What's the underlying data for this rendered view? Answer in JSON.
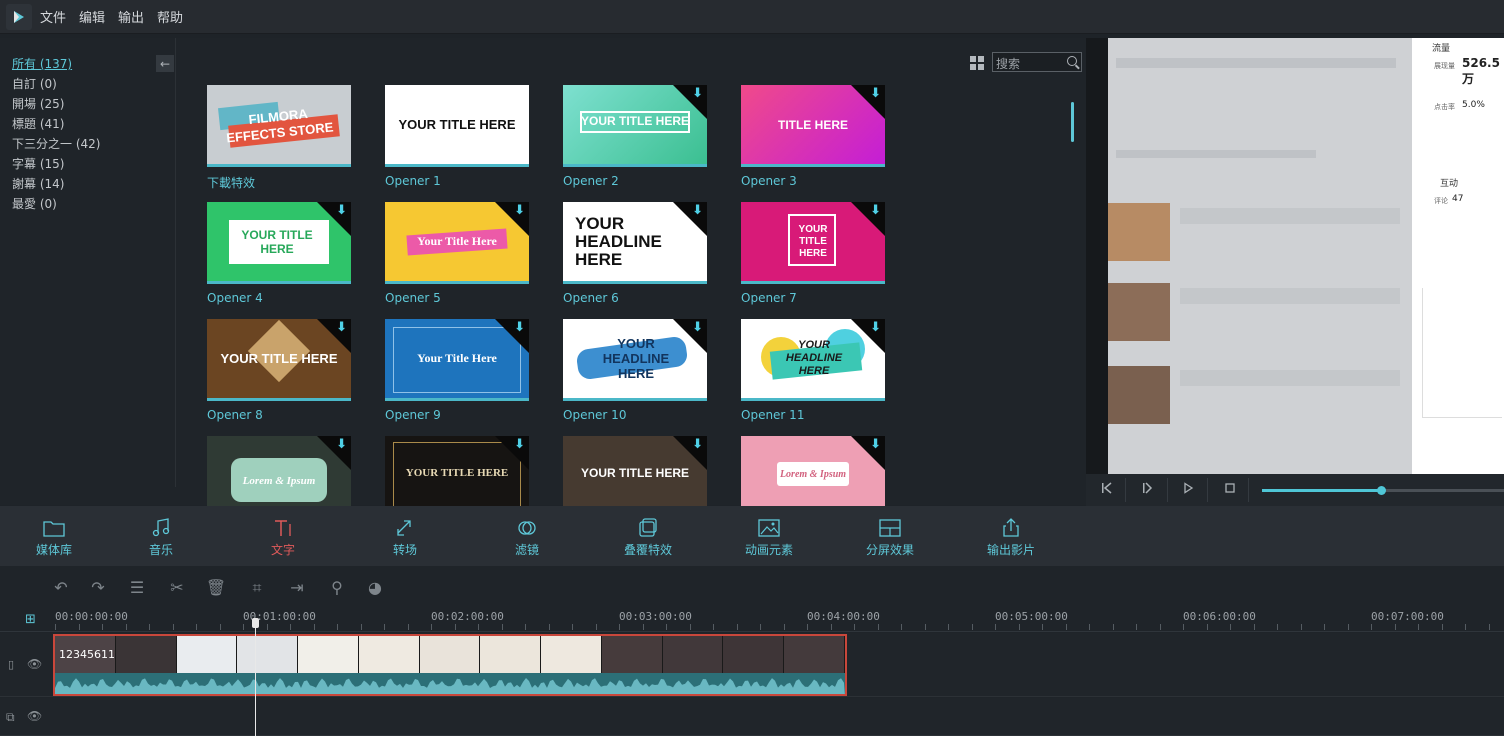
{
  "menu": {
    "items": [
      "文件",
      "编辑",
      "输出",
      "帮助"
    ]
  },
  "sidebar": {
    "categories": [
      {
        "label": "所有 (137)"
      },
      {
        "label": "自訂 (0)"
      },
      {
        "label": "開場 (25)"
      },
      {
        "label": "標題 (41)"
      },
      {
        "label": "下三分之一 (42)"
      },
      {
        "label": "字幕 (15)"
      },
      {
        "label": "謝幕 (14)"
      },
      {
        "label": "最愛 (0)"
      }
    ]
  },
  "search": {
    "placeholder": "搜索"
  },
  "library": {
    "tiles": [
      {
        "label": "下載特效",
        "text": "FILMORA EFFECTS STORE"
      },
      {
        "label": "Opener 1",
        "text": "YOUR TITLE HERE"
      },
      {
        "label": "Opener 2",
        "text": "YOUR TITLE HERE"
      },
      {
        "label": "Opener 3",
        "text": "TITLE HERE"
      },
      {
        "label": "Opener 4",
        "text": "YOUR TITLE HERE"
      },
      {
        "label": "Opener 5",
        "text": "Your Title Here"
      },
      {
        "label": "Opener 6",
        "text": "YOUR HEADLINE HERE"
      },
      {
        "label": "Opener 7",
        "text": "YOUR TITLE HERE"
      },
      {
        "label": "Opener 8",
        "text": "YOUR TITLE HERE"
      },
      {
        "label": "Opener 9",
        "text": "Your Title Here"
      },
      {
        "label": "Opener 10",
        "text": "YOUR HEADLINE HERE"
      },
      {
        "label": "Opener 11",
        "text": "YOUR HEADLINE HERE"
      },
      {
        "label": "",
        "text": "Lorem & Ipsum"
      },
      {
        "label": "",
        "text": "YOUR TITLE HERE"
      },
      {
        "label": "",
        "text": "YOUR TITLE HERE"
      },
      {
        "label": "",
        "text": "Lorem & Ipsum"
      }
    ]
  },
  "tabs": [
    {
      "label": "媒体库",
      "icon": "folder-icon"
    },
    {
      "label": "音乐",
      "icon": "music-icon"
    },
    {
      "label": "文字",
      "icon": "text-icon"
    },
    {
      "label": "转场",
      "icon": "transition-icon"
    },
    {
      "label": "滤镜",
      "icon": "filter-icon"
    },
    {
      "label": "叠覆特效",
      "icon": "overlay-icon"
    },
    {
      "label": "动画元素",
      "icon": "element-icon"
    },
    {
      "label": "分屏效果",
      "icon": "splitscreen-icon"
    },
    {
      "label": "输出影片",
      "icon": "export-icon"
    }
  ],
  "timeline": {
    "ruler": [
      "00:00:00:00",
      "00:01:00:00",
      "00:02:00:00",
      "00:03:00:00",
      "00:04:00:00",
      "00:05:00:00",
      "00:06:00:00",
      "00:07:00:00"
    ],
    "clip_name": "12345611",
    "playhead_fraction": 0.25
  },
  "preview": {
    "stats": {
      "section1": "流量",
      "views_label": "展现量",
      "views_value": "526.5万",
      "ratio_label": "点击率",
      "ratio_value": "5.0%",
      "section2": "互动",
      "comments_label": "评论",
      "comments_value": "47"
    }
  }
}
